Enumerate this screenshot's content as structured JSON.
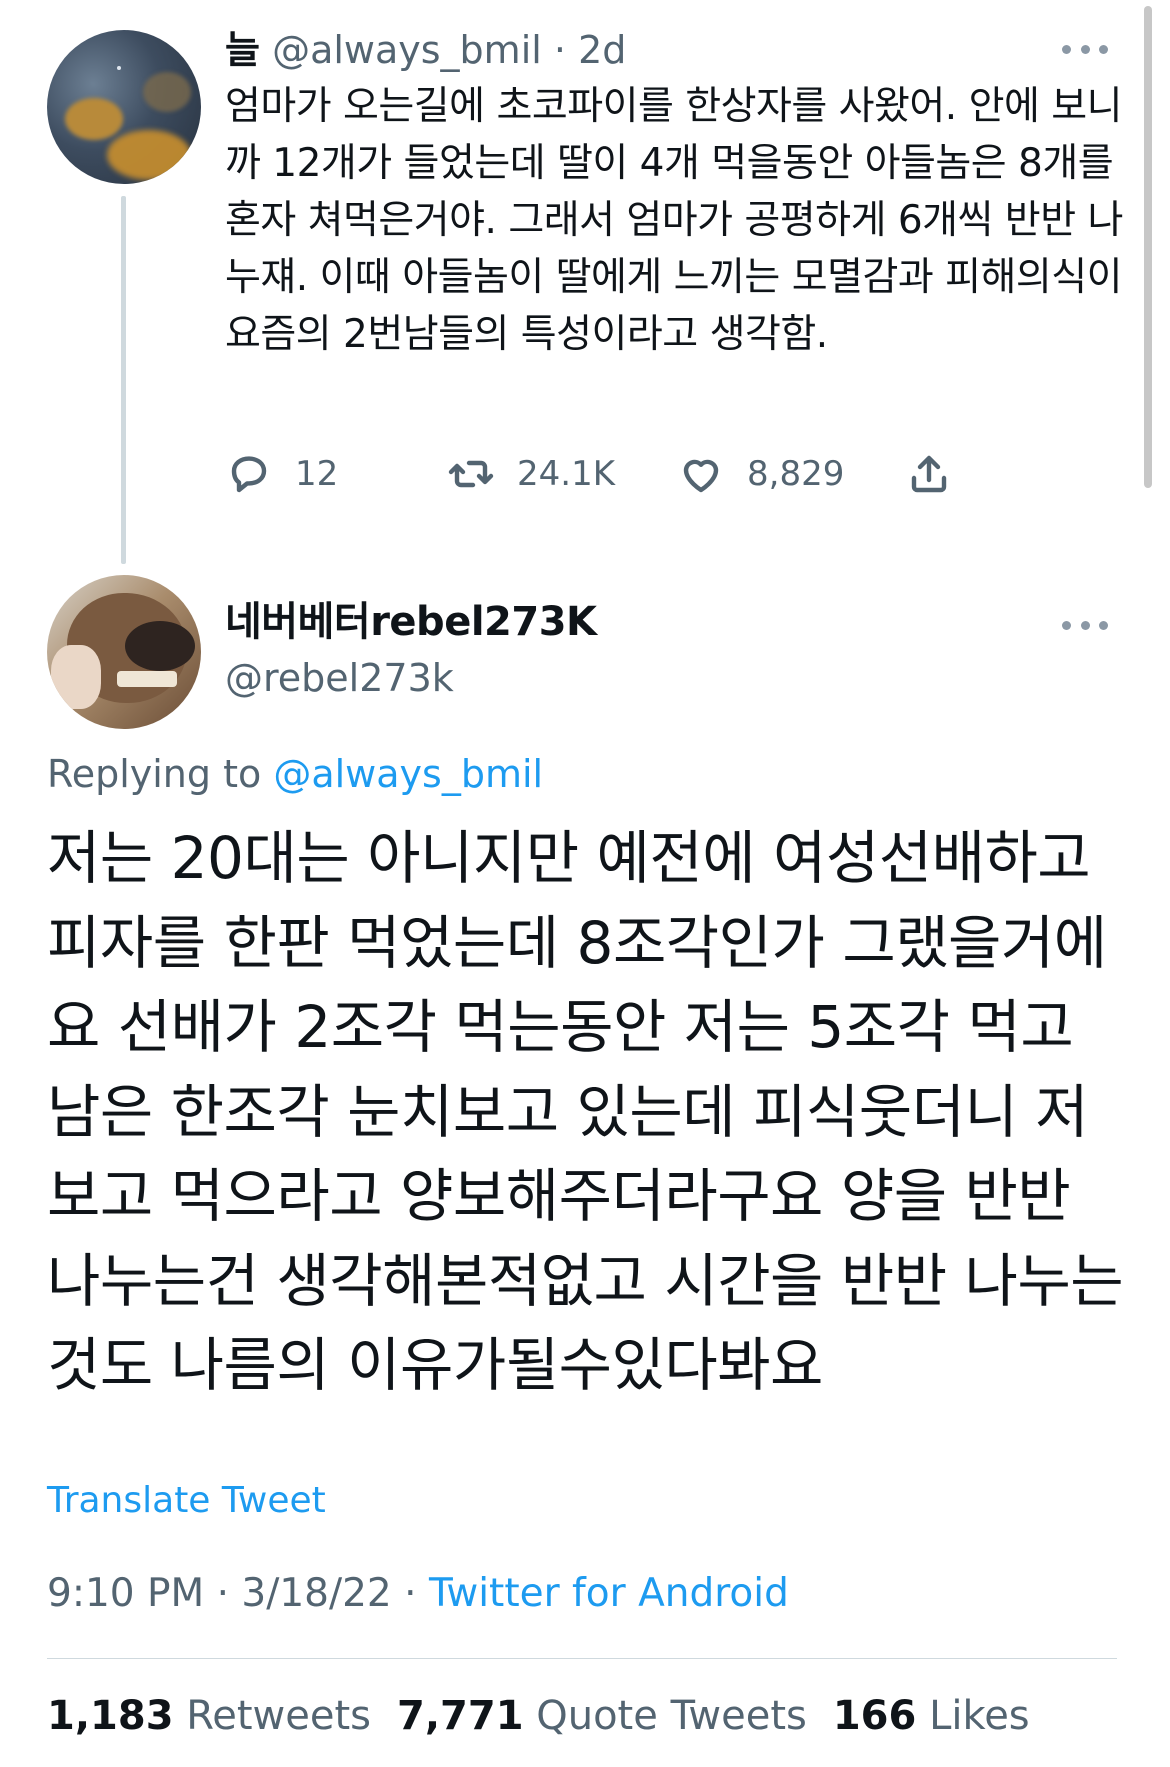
{
  "parent_tweet": {
    "display_name": "늘",
    "handle": "@always_bmil",
    "separator": "·",
    "time": "2d",
    "text": "엄마가 오는길에 초코파이를 한상자를 사왔어. 안에 보니까 12개가 들었는데 딸이 4개 먹을동안 아들놈은 8개를 혼자 쳐먹은거야. 그래서 엄마가 공평하게 6개씩 반반 나누쟤. 이때 아들놈이 딸에게 느끼는 모멸감과 피해의식이 요즘의 2번남들의 특성이라고 생각함.",
    "replies": "12",
    "retweets": "24.1K",
    "likes": "8,829",
    "icons": [
      "reply-icon",
      "retweet-icon",
      "like-icon",
      "share-icon",
      "more-icon"
    ]
  },
  "main_tweet": {
    "display_name": "네버베터rebel273K",
    "handle": "@rebel273k",
    "replying_prefix": "Replying to",
    "replying_to": "@always_bmil",
    "text": "저는 20대는 아니지만 예전에 여성선배하고 피자를 한판 먹었는데 8조각인가 그랬을거에요 선배가 2조각 먹는동안 저는 5조각 먹고 남은 한조각 눈치보고 있는데 피식웃더니 저보고 먹으라고 양보해주더라구요 양을 반반 나누는건 생각해본적없고 시간을 반반 나누는것도 나름의 이유가될수있다봐요",
    "translate_label": "Translate Tweet",
    "time": "9:10 PM",
    "date": "3/18/22",
    "separator": "·",
    "source": "Twitter for Android",
    "retweets_count": "1,183",
    "retweets_label": "Retweets",
    "quotes_count": "7,771",
    "quotes_label": "Quote Tweets",
    "likes_count": "166",
    "likes_label": "Likes"
  },
  "colors": {
    "text": "#0f1419",
    "secondary": "#536471",
    "link": "#1d9bf0",
    "divider": "#cfd9de"
  }
}
